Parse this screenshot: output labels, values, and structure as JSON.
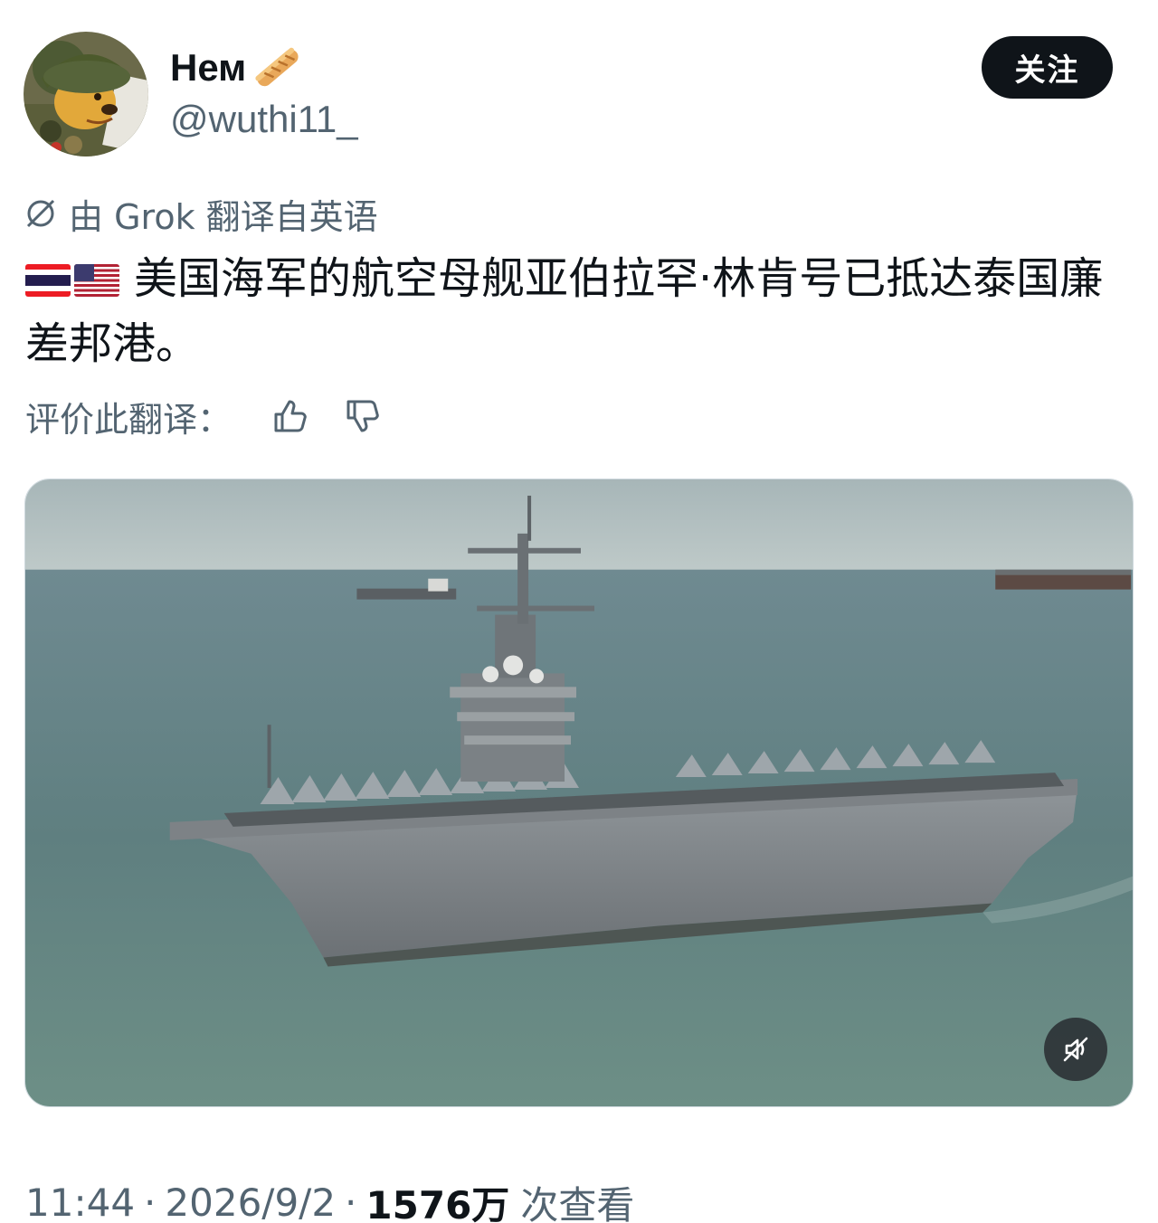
{
  "author": {
    "display_name": "Нем",
    "handle": "@wuthi11_",
    "name_emoji_icon": "baguette-icon"
  },
  "follow_button": {
    "label": "关注"
  },
  "translation": {
    "note": "由 Grok 翻译自英语",
    "icon": "grok-translate-icon"
  },
  "tweet": {
    "flags": [
      "thailand-flag",
      "usa-flag"
    ],
    "text": "美国海军的航空母舰亚伯拉罕·林肯号已抵达泰国廉差邦港。"
  },
  "rating": {
    "label": "评价此翻译：",
    "like_icon": "thumbs-up-icon",
    "dislike_icon": "thumbs-down-icon"
  },
  "media": {
    "type": "video",
    "mute_icon": "muted-speaker-icon"
  },
  "meta": {
    "time": "11:44",
    "date": "2026/9/2",
    "views_count": "1576万",
    "views_label": "次查看",
    "separator": "·"
  },
  "colors": {
    "text_primary": "#0f1419",
    "text_secondary": "#536471",
    "follow_bg": "#0f1419"
  }
}
